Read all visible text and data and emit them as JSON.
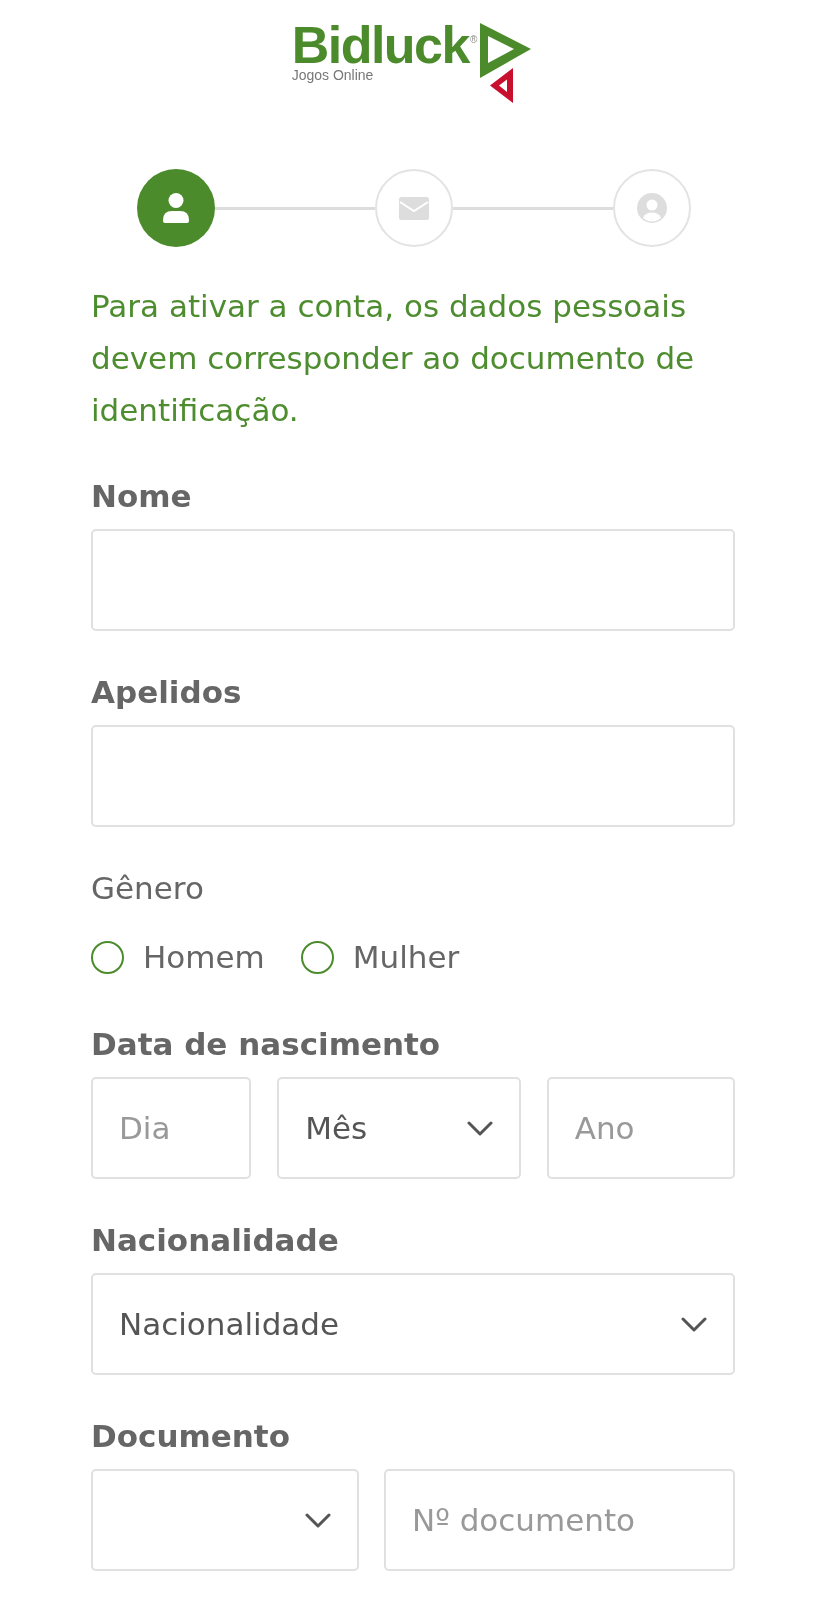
{
  "logo": {
    "wordmark": "Bidluck",
    "mark": "®",
    "tagline": "Jogos Online"
  },
  "steps": [
    {
      "kind": "person",
      "selected": true
    },
    {
      "kind": "envelope",
      "selected": false
    },
    {
      "kind": "account",
      "selected": false
    }
  ],
  "notice": "Para ativar a conta, os dados pessoais devem corresponder ao documento de identificação.",
  "form": [
    {
      "kind": "text",
      "label": "Nome"
    },
    {
      "kind": "text",
      "label": "Apelidos"
    },
    {
      "kind": "radio",
      "label": "Gênero",
      "options": [
        {
          "label": "Homem",
          "selected": false
        },
        {
          "label": "Mulher",
          "selected": false
        }
      ]
    },
    {
      "kind": "group",
      "label": "Data de nascimento",
      "parts": [
        {
          "kind": "input",
          "placeholder": "Dia"
        },
        {
          "kind": "select",
          "value": "Mês"
        },
        {
          "kind": "input",
          "placeholder": "Ano"
        }
      ]
    },
    {
      "kind": "select",
      "label": "Nacionalidade",
      "value": "Nacionalidade"
    },
    {
      "kind": "group",
      "label": "Documento",
      "parts": [
        {
          "kind": "select"
        },
        {
          "kind": "input",
          "placeholder": "Nº documento"
        }
      ]
    }
  ]
}
